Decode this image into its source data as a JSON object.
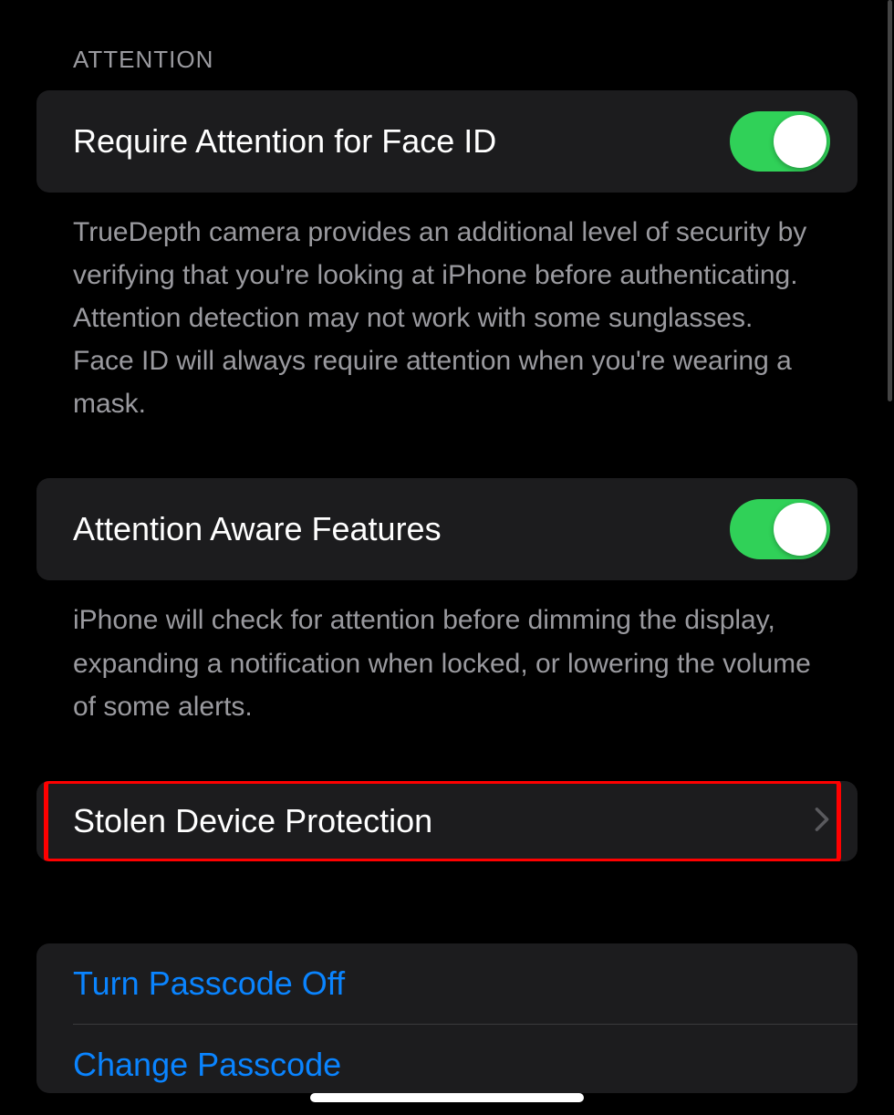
{
  "sections": {
    "attention": {
      "header": "ATTENTION",
      "requireAttention": {
        "label": "Require Attention for Face ID",
        "description": "TrueDepth camera provides an additional level of security by verifying that you're looking at iPhone before authenticating. Attention detection may not work with some sunglasses. Face ID will always require attention when you're wearing a mask."
      },
      "attentionAware": {
        "label": "Attention Aware Features",
        "description": "iPhone will check for attention before dimming the display, expanding a notification when locked, or lowering the volume of some alerts."
      }
    },
    "stolenDevice": {
      "label": "Stolen Device Protection"
    },
    "passcode": {
      "turnOff": "Turn Passcode Off",
      "change": "Change Passcode"
    }
  }
}
